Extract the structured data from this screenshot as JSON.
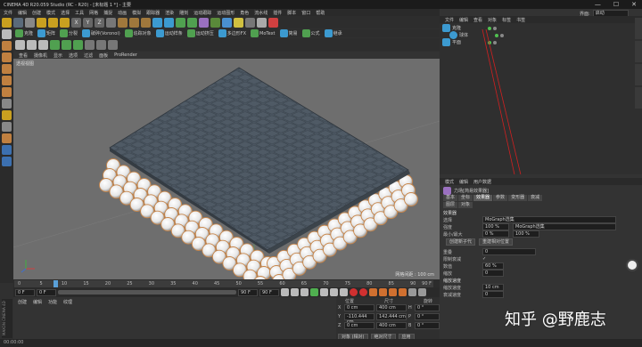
{
  "window": {
    "title": "CINEMA 4D R20.059 Studio (RC - R20) - [未标题 1 *] - 主要",
    "minimize": "—",
    "maximize": "☐",
    "close": "✕"
  },
  "menu": [
    "文件",
    "编辑",
    "创建",
    "模式",
    "选择",
    "工具",
    "网格",
    "捕捉",
    "动画",
    "模拟",
    "跟踪器",
    "渲染",
    "雕刻",
    "运动跟踪",
    "运动图形",
    "角色",
    "流水线",
    "插件",
    "脚本",
    "窗口",
    "帮助"
  ],
  "right_top": {
    "interface_label": "界面:",
    "interface_value": "启动"
  },
  "top_toolbar_labels": [
    "XYZ"
  ],
  "mograph_toolbar": [
    "克隆",
    "矩阵",
    "分裂",
    "破碎(Voronoi)",
    "追踪对象",
    "运动样条",
    "运动挤压",
    "多边形FX",
    "MoText",
    "简易",
    "公式",
    "继承",
    "推散",
    "Python",
    "随机",
    "着色",
    "声音",
    "样条",
    "步幅",
    "目标",
    "时间",
    "体积"
  ],
  "viewport": {
    "menu": [
      "查看",
      "摄像机",
      "显示",
      "选项",
      "过滤",
      "面板",
      "ProRender"
    ],
    "label": "透视视图",
    "grid_info": "网格间距 : 100 cm"
  },
  "timeline": {
    "ticks": [
      "0",
      "5",
      "10",
      "15",
      "20",
      "25",
      "30",
      "35",
      "40",
      "45",
      "50",
      "55",
      "60",
      "65",
      "70",
      "75",
      "80",
      "85",
      "90"
    ],
    "end_tick": "90 F",
    "current_frame": "0 F",
    "min_frame": "0 F",
    "max_frame": "90 F",
    "end_frame": "90 F",
    "playhead": 0.09
  },
  "material_manager": {
    "menu": [
      "创建",
      "编辑",
      "功能",
      "纹理"
    ]
  },
  "coordinates": {
    "headers": [
      "位置",
      "尺寸",
      "旋转"
    ],
    "rows": [
      {
        "axis": "X",
        "pos": "0 cm",
        "size": "400 cm",
        "rot_axis": "H",
        "rot": "0 °"
      },
      {
        "axis": "Y",
        "pos": "-110.444 cm",
        "size": "142.444 cm",
        "rot_axis": "P",
        "rot": "0 °"
      },
      {
        "axis": "Z",
        "pos": "0 cm",
        "size": "400 cm",
        "rot_axis": "B",
        "rot": "0 °"
      }
    ],
    "mode": "对象 (相对)",
    "size_mode": "绝对尺寸",
    "apply": "应用"
  },
  "object_manager": {
    "menu": [
      "文件",
      "编辑",
      "查看",
      "对象",
      "标签",
      "书签"
    ],
    "objects": [
      {
        "name": "克隆"
      },
      {
        "name": "球体"
      },
      {
        "name": "平面"
      }
    ]
  },
  "attributes": {
    "menu": [
      "模式",
      "编辑",
      "用户数据"
    ],
    "object_title": "力场[简易效果器]",
    "tabs": [
      "基本",
      "坐标",
      "效果器",
      "参数",
      "变形器",
      "衰减"
    ],
    "tabs2": [
      "图层",
      "对象"
    ],
    "section_title": "效果器",
    "rows": [
      {
        "key": "选择",
        "value": "MoGraph选集"
      },
      {
        "key": "强度",
        "value": "100 %",
        "extra": "MoGraph选集"
      },
      {
        "key": "最小/最大",
        "value": "0 %",
        "extra": "100 %"
      }
    ],
    "buttons": [
      "创建新子代",
      "重建相对位置"
    ],
    "settings": [
      {
        "key": "重叠",
        "value": "0"
      },
      {
        "key": "限制衰减",
        "value": "✓"
      },
      {
        "key": "数值",
        "value": "60 %"
      },
      {
        "key": "缩放",
        "value": "0"
      }
    ],
    "section2": "缩放速度",
    "speed_rows": [
      {
        "key": "缩放速度",
        "value": "10 cm"
      },
      {
        "key": "衰减速度",
        "value": "0"
      }
    ]
  },
  "statusbar": "00:00:00",
  "maxon_logo": "MAXON CINEMA 4D",
  "watermark": "知乎 @野鹿志",
  "colors": {
    "accent": "#5aa0d8",
    "viewport": "#6e6e6e",
    "plane": "#4a5560",
    "sphere": "#f2f2f2",
    "edge": "#c8864a"
  }
}
